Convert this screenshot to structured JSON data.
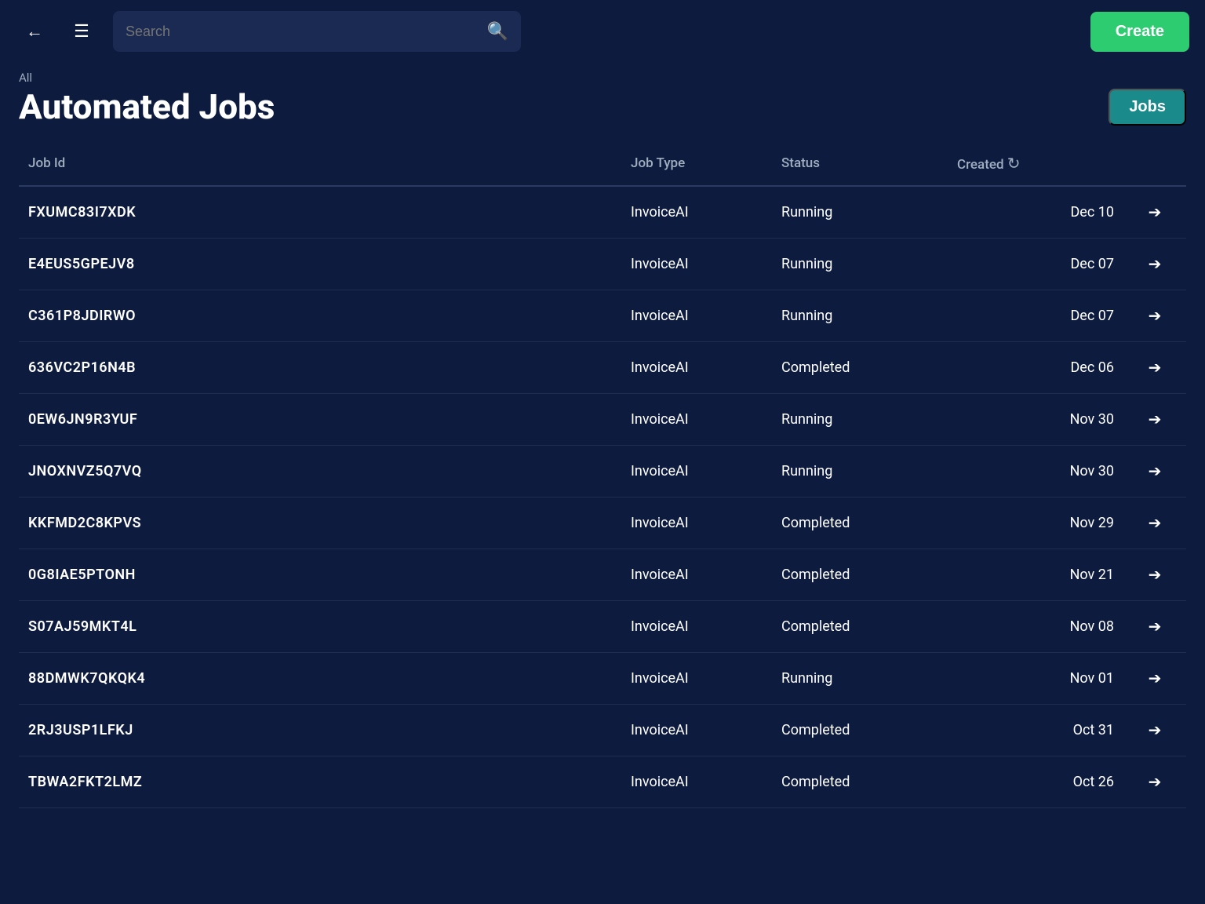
{
  "navbar": {
    "search_placeholder": "Search",
    "create_label": "Create"
  },
  "page_header": {
    "breadcrumb": "All",
    "title": "Automated Jobs",
    "jobs_badge": "Jobs"
  },
  "table": {
    "columns": [
      {
        "key": "job_id",
        "label": "Job Id"
      },
      {
        "key": "job_type",
        "label": "Job Type"
      },
      {
        "key": "status",
        "label": "Status"
      },
      {
        "key": "created",
        "label": "Created"
      },
      {
        "key": "action",
        "label": ""
      }
    ],
    "rows": [
      {
        "job_id": "FXUMC83I7XDK",
        "job_type": "InvoiceAI",
        "status": "Running",
        "created": "Dec 10"
      },
      {
        "job_id": "E4EUS5GPEJV8",
        "job_type": "InvoiceAI",
        "status": "Running",
        "created": "Dec 07"
      },
      {
        "job_id": "C361P8JDIRWO",
        "job_type": "InvoiceAI",
        "status": "Running",
        "created": "Dec 07"
      },
      {
        "job_id": "636VC2P16N4B",
        "job_type": "InvoiceAI",
        "status": "Completed",
        "created": "Dec 06"
      },
      {
        "job_id": "0EW6JN9R3YUF",
        "job_type": "InvoiceAI",
        "status": "Running",
        "created": "Nov 30"
      },
      {
        "job_id": "JNOXNVZ5Q7VQ",
        "job_type": "InvoiceAI",
        "status": "Running",
        "created": "Nov 30"
      },
      {
        "job_id": "KKFMD2C8KPVS",
        "job_type": "InvoiceAI",
        "status": "Completed",
        "created": "Nov 29"
      },
      {
        "job_id": "0G8IAE5PTONH",
        "job_type": "InvoiceAI",
        "status": "Completed",
        "created": "Nov 21"
      },
      {
        "job_id": "S07AJ59MKT4L",
        "job_type": "InvoiceAI",
        "status": "Completed",
        "created": "Nov 08"
      },
      {
        "job_id": "88DMWK7QKQK4",
        "job_type": "InvoiceAI",
        "status": "Running",
        "created": "Nov 01"
      },
      {
        "job_id": "2RJ3USP1LFKJ",
        "job_type": "InvoiceAI",
        "status": "Completed",
        "created": "Oct 31"
      },
      {
        "job_id": "TBWA2FKT2LMZ",
        "job_type": "InvoiceAI",
        "status": "Completed",
        "created": "Oct 26"
      }
    ]
  }
}
